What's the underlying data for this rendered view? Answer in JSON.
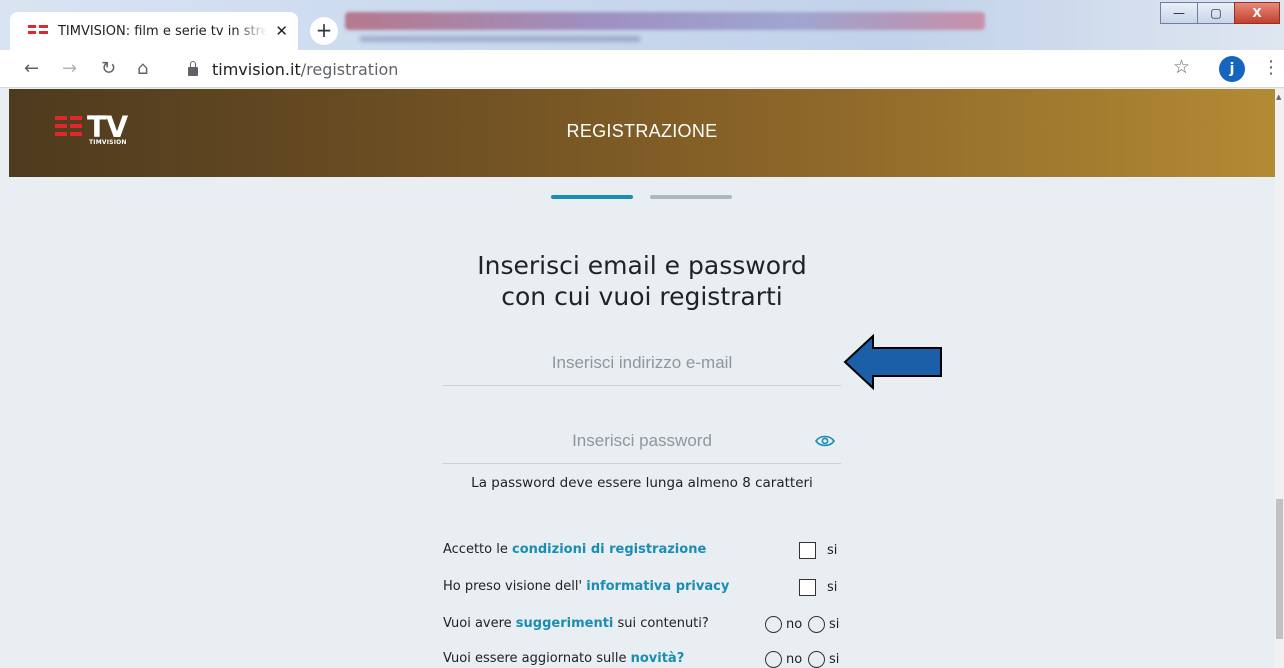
{
  "browser": {
    "tab_title": "TIMVISION: film e serie tv in streaming",
    "tab_close": "✕",
    "new_tab": "+",
    "url_host": "timvision.it",
    "url_path": "/registration",
    "avatar_letter": "j",
    "window_buttons": {
      "minimize": "—",
      "maximize": "▢",
      "close": "X"
    }
  },
  "header": {
    "logo_text": "TV",
    "logo_sub": "TIMVISION",
    "title": "REGISTRAZIONE"
  },
  "steps": {
    "current": 1,
    "total": 2
  },
  "form": {
    "heading_line1": "Inserisci email e password",
    "heading_line2": "con cui vuoi registrarti",
    "email_placeholder": "Inserisci indirizzo e-mail",
    "password_placeholder": "Inserisci password",
    "password_hint": "La password deve essere lunga almeno 8 caratteri",
    "consents": [
      {
        "prefix": "Accetto le ",
        "link": "condizioni di registrazione",
        "suffix": "",
        "option": "si"
      },
      {
        "prefix": "Ho preso visione dell' ",
        "link": "informativa privacy",
        "suffix": "",
        "option": "si"
      }
    ],
    "preferences": [
      {
        "prefix": "Vuoi avere ",
        "link": "suggerimenti",
        "suffix": " sui contenuti?",
        "no": "no",
        "si": "si"
      },
      {
        "prefix": "Vuoi essere aggiornato sulle ",
        "link": "novità?",
        "suffix": "",
        "no": "no",
        "si": "si"
      }
    ]
  },
  "colors": {
    "accent": "#1b8db4",
    "arrow_fill": "#1a5fa8",
    "header_start": "#4e3a1e",
    "header_end": "#b38a34",
    "brand_red": "#e1262d"
  }
}
